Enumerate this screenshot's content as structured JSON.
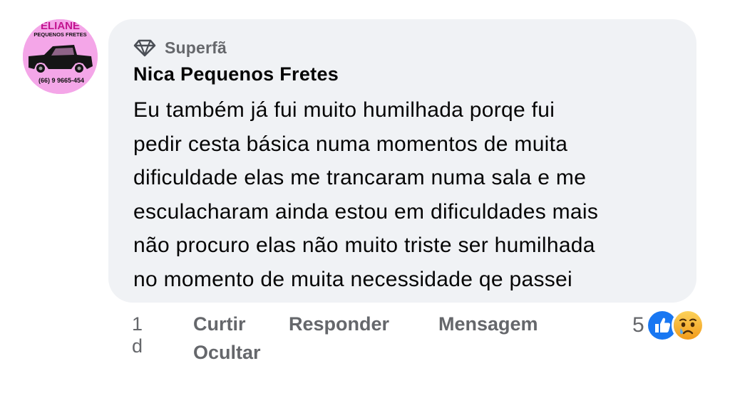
{
  "avatar": {
    "brand_top": "ELIANE",
    "brand_sub": "PEQUENOS FRETES",
    "phone": "(66) 9 9665-454"
  },
  "comment": {
    "badge_label": "Superfã",
    "badge_icon": "diamond-icon",
    "author": "Nica Pequenos Fretes",
    "lines": [
      "Eu também já fui muito humilhada porqe fui",
      "pedir cesta básica numa momentos de muita",
      "dificuldade elas me trancaram numa sala e me",
      "esculacharam ainda estou em dificuldades mais",
      "não procuro elas não muito triste ser humilhada",
      "no momento de muita necessidade qe passei"
    ]
  },
  "actions": {
    "time": "1 d",
    "like": "Curtir",
    "reply": "Responder",
    "message": "Mensagem",
    "hide": "Ocultar"
  },
  "reactions": {
    "count": "5",
    "icons": [
      "like-icon",
      "sad-icon"
    ]
  },
  "colors": {
    "bubble": "#f0f2f5",
    "secondary_text": "#65676b",
    "primary_text": "#050505",
    "like_blue": "#1877f2",
    "sad_yellow": "#f7b125",
    "avatar_pink": "#f4a6e8"
  }
}
